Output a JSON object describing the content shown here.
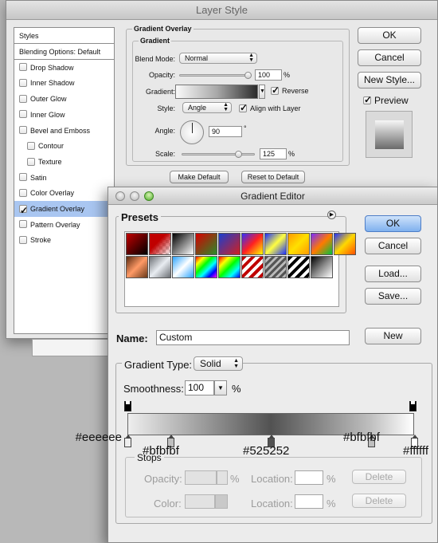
{
  "layer_style": {
    "title": "Layer Style",
    "list_header": "Styles",
    "list": [
      {
        "label": "Blending Options: Default",
        "checkbox": false,
        "header": true
      },
      {
        "label": "Drop Shadow",
        "checkbox": true,
        "checked": false
      },
      {
        "label": "Inner Shadow",
        "checkbox": true,
        "checked": false
      },
      {
        "label": "Outer Glow",
        "checkbox": true,
        "checked": false
      },
      {
        "label": "Inner Glow",
        "checkbox": true,
        "checked": false
      },
      {
        "label": "Bevel and Emboss",
        "checkbox": true,
        "checked": false
      },
      {
        "label": "Contour",
        "checkbox": true,
        "checked": false,
        "indent": true
      },
      {
        "label": "Texture",
        "checkbox": true,
        "checked": false,
        "indent": true
      },
      {
        "label": "Satin",
        "checkbox": true,
        "checked": false
      },
      {
        "label": "Color Overlay",
        "checkbox": true,
        "checked": false
      },
      {
        "label": "Gradient Overlay",
        "checkbox": true,
        "checked": true,
        "selected": true
      },
      {
        "label": "Pattern Overlay",
        "checkbox": true,
        "checked": false
      },
      {
        "label": "Stroke",
        "checkbox": true,
        "checked": false
      }
    ],
    "panel_title": "Gradient Overlay",
    "group_title": "Gradient",
    "blend_mode_label": "Blend Mode:",
    "blend_mode_value": "Normal",
    "opacity_label": "Opacity:",
    "opacity_value": "100",
    "opacity_unit": "%",
    "gradient_label": "Gradient:",
    "reverse_label": "Reverse",
    "reverse_checked": true,
    "style_label": "Style:",
    "style_value": "Angle",
    "align_label": "Align with Layer",
    "align_checked": true,
    "angle_label": "Angle:",
    "angle_value": "90",
    "angle_unit": "°",
    "scale_label": "Scale:",
    "scale_value": "125",
    "scale_unit": "%",
    "make_default": "Make Default",
    "reset_default": "Reset to Default",
    "ok": "OK",
    "cancel": "Cancel",
    "new_style": "New Style...",
    "preview_label": "Preview",
    "preview_checked": true
  },
  "gradient_editor": {
    "title": "Gradient Editor",
    "presets_label": "Presets",
    "ok": "OK",
    "cancel": "Cancel",
    "load": "Load...",
    "save": "Save...",
    "name_label": "Name:",
    "name_value": "Custom",
    "new_button": "New",
    "gradient_type_label": "Gradient Type:",
    "gradient_type_value": "Solid",
    "smoothness_label": "Smoothness:",
    "smoothness_value": "100",
    "smoothness_unit": "%",
    "stops_label": "Stops",
    "opacity_label": "Opacity:",
    "color_label": "Color:",
    "location_label": "Location:",
    "percent": "%",
    "delete": "Delete",
    "color_stops": [
      {
        "hex": "#eeeeee",
        "location": 0
      },
      {
        "hex": "#bfbfbf",
        "location": 15
      },
      {
        "hex": "#525252",
        "location": 50
      },
      {
        "hex": "#bfbfbf",
        "location": 85
      },
      {
        "hex": "#ffffff",
        "location": 100
      }
    ],
    "presets": [
      "linear-gradient(135deg,#c00000,#000)",
      "linear-gradient(135deg,#c00000 40%,transparent)",
      "linear-gradient(135deg,#000,#fff)",
      "linear-gradient(135deg,#d70000,#2a8a2a)",
      "linear-gradient(135deg,#1a3fd0,#d11f1f)",
      "linear-gradient(135deg,#3030ff,#ff2020,#ffff00)",
      "linear-gradient(135deg,#1a2dff,#ffff40,#1a2dff)",
      "linear-gradient(135deg,#ff9900,#ffe000,#ff9900)",
      "linear-gradient(135deg,#7a2cff,#ff7a00,#00c040)",
      "linear-gradient(135deg,#2030ff,#ffd800,#ff5000)",
      "linear-gradient(135deg,#5a2a10,#ff9a66,#6a3a1a)",
      "linear-gradient(135deg,#6b6f74,#e9edf2,#6b6f74)",
      "linear-gradient(135deg,#2aa3ff,#ffffff,#2aa3ff)",
      "linear-gradient(135deg,#ff0000,#ffff00,#00ff00,#00ffff,#0000ff,#ff00ff)",
      "linear-gradient(135deg,#ff0000,#ffff00,#00ff00,#00ffff,#0000ff)",
      "repeating-linear-gradient(135deg,#c00000 0 4px,#ffffff 4px 8px)",
      "repeating-linear-gradient(135deg,#555 0 3px,#bbb 3px 6px)",
      "repeating-linear-gradient(135deg,#000 0 4px,#ffffff 4px 8px)",
      "linear-gradient(135deg,#000,#888,#fff)"
    ]
  }
}
